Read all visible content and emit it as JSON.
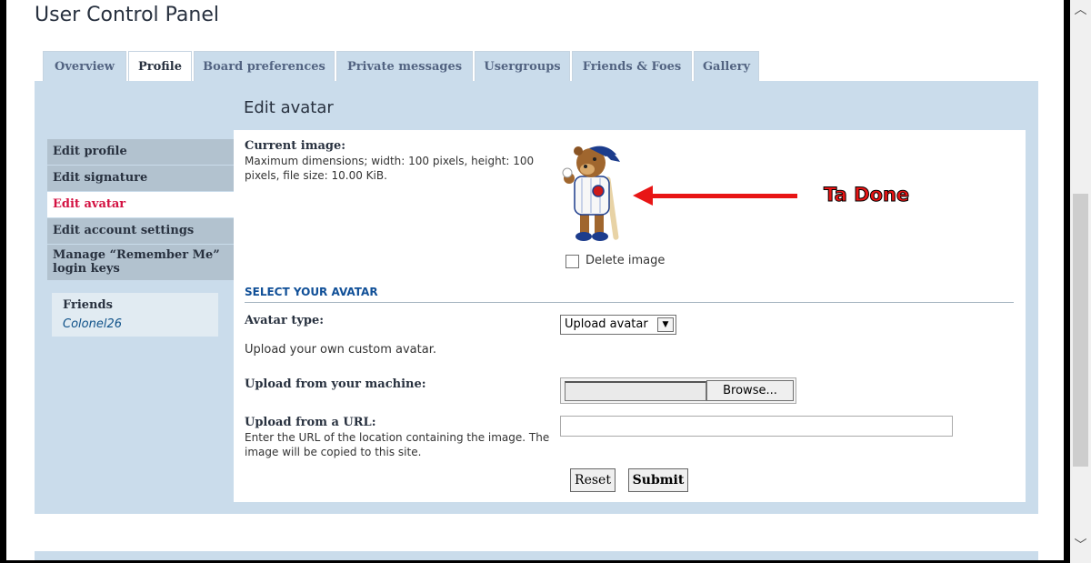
{
  "page": {
    "title": "User Control Panel"
  },
  "tabs": [
    {
      "label": "Overview"
    },
    {
      "label": "Profile",
      "active": true
    },
    {
      "label": "Board preferences"
    },
    {
      "label": "Private messages"
    },
    {
      "label": "Usergroups"
    },
    {
      "label": "Friends & Foes"
    },
    {
      "label": "Gallery"
    }
  ],
  "sidemenu": [
    {
      "label": "Edit profile"
    },
    {
      "label": "Edit signature"
    },
    {
      "label": "Edit avatar",
      "active": true
    },
    {
      "label": "Edit account settings"
    },
    {
      "label": "Manage “Remember Me” login keys"
    }
  ],
  "friends": {
    "title": "Friends",
    "items": [
      "Colonel26"
    ]
  },
  "main": {
    "heading": "Edit avatar",
    "current_image_label": "Current image:",
    "current_image_desc": "Maximum dimensions; width: 100 pixels, height: 100 pixels, file size: 10.00 KiB.",
    "annotation": "Ta Done",
    "delete_label": "Delete image",
    "delete_checked": false,
    "section_title": "SELECT YOUR AVATAR",
    "avatar_type_label": "Avatar type:",
    "avatar_type_value": "Upload avatar",
    "upload_desc": "Upload your own custom avatar.",
    "upload_machine_label": "Upload from your machine:",
    "browse_label": "Browse...",
    "upload_url_label": "Upload from a URL:",
    "upload_url_desc": "Enter the URL of the location containing the image. The image will be copied to this site.",
    "url_value": "",
    "reset_label": "Reset",
    "submit_label": "Submit"
  },
  "colors": {
    "panel_bg": "#cadceb",
    "tab_text": "#536482",
    "active_menu_text": "#d31141",
    "annotation_red": "#e81515",
    "section_title": "#115098"
  },
  "icons": {
    "scroll_up": "chevron-up-icon",
    "scroll_down": "chevron-down-icon",
    "select_arrow": "chevron-down-icon",
    "arrow": "arrow-left-icon"
  }
}
